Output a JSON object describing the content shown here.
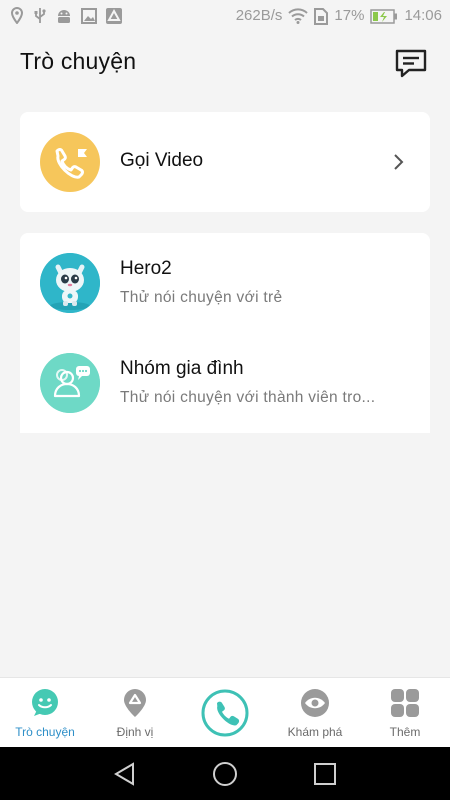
{
  "status_bar": {
    "network_speed": "262B/s",
    "battery": "17%",
    "time": "14:06"
  },
  "header": {
    "title": "Trò chuyện",
    "compose_icon": "message-compose-icon"
  },
  "video_call": {
    "label": "Gọi Video",
    "icon": "video-call-icon",
    "accent": "#f6c65b"
  },
  "chats": [
    {
      "title": "Hero2",
      "subtitle": "Thử nói chuyện với trẻ",
      "avatar": "robot-cat-avatar",
      "accent": "#2fb6c9"
    },
    {
      "title": "Nhóm gia đình",
      "subtitle": "Thử nói chuyện với thành viên tro...",
      "avatar": "family-group-icon",
      "accent": "#6ed9c6"
    }
  ],
  "bottom_nav": {
    "items": [
      {
        "label": "Trò chuyện",
        "icon": "chat-icon",
        "active": true
      },
      {
        "label": "Định vị",
        "icon": "location-pin-icon",
        "active": false
      },
      {
        "label": "",
        "icon": "call-icon",
        "active": false
      },
      {
        "label": "Khám phá",
        "icon": "eye-icon",
        "active": false
      },
      {
        "label": "Thêm",
        "icon": "grid-icon",
        "active": false
      }
    ],
    "active_color": "#2e8fc8",
    "call_color": "#3ec1b5"
  }
}
